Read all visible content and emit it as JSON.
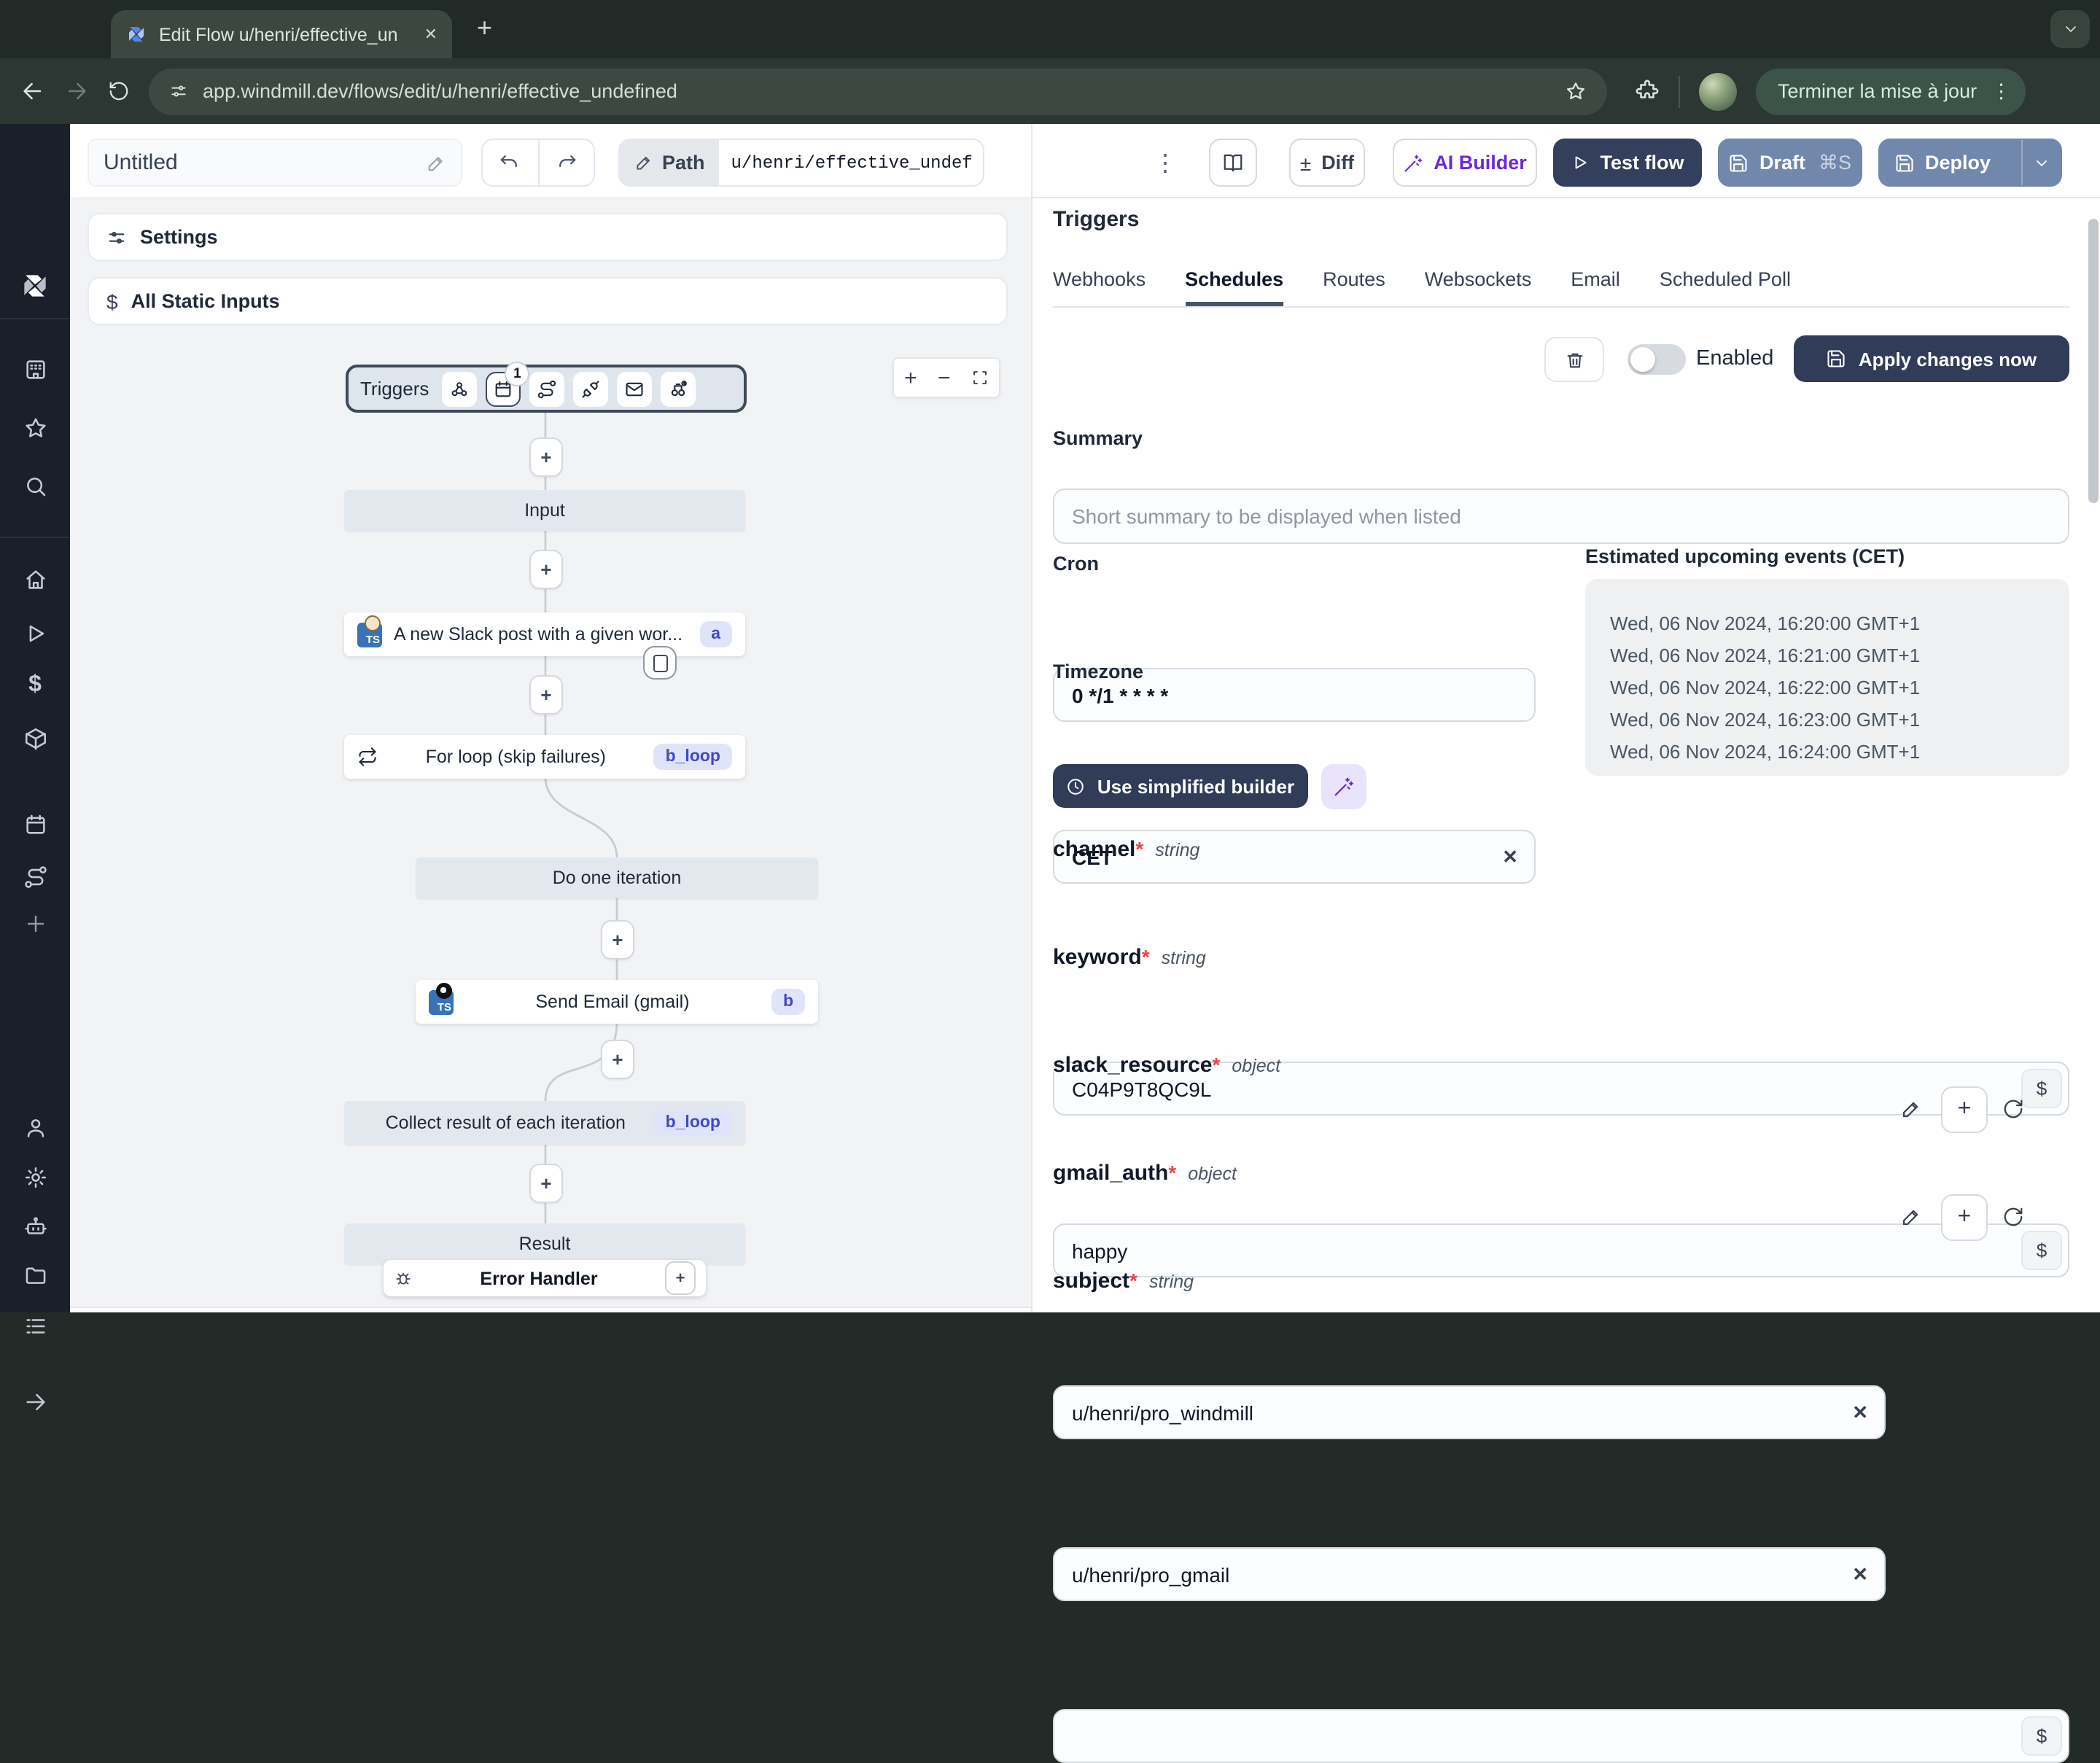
{
  "browser": {
    "tab_title": "Edit Flow u/henri/effective_un",
    "url": "app.windmill.dev/flows/edit/u/henri/effective_undefined",
    "update_button_label": "Terminer la mise à jour"
  },
  "header": {
    "flow_name": "Untitled",
    "path_label": "Path",
    "path_value": "u/henri/effective_undef",
    "diff_label": "Diff",
    "ai_builder_label": "AI Builder",
    "test_flow_label": "Test flow",
    "draft_label": "Draft",
    "draft_shortcut": "⌘S",
    "deploy_label": "Deploy"
  },
  "flow_panel": {
    "settings_label": "Settings",
    "all_static_inputs_label": "All Static Inputs",
    "triggers_node_label": "Triggers",
    "schedule_count_badge": "1",
    "nodes": {
      "input_label": "Input",
      "slack": {
        "label": "A new Slack post with a given wor...",
        "badge": "a"
      },
      "forloop": {
        "label": "For loop (skip failures)",
        "badge": "b_loop"
      },
      "iteration_label": "Do one iteration",
      "email": {
        "label": "Send Email (gmail)",
        "badge": "b"
      },
      "collect": {
        "label": "Collect result of each iteration",
        "badge": "b_loop"
      },
      "result_label": "Result",
      "error_handler_label": "Error Handler"
    }
  },
  "panel": {
    "title": "Triggers",
    "tabs": [
      "Webhooks",
      "Schedules",
      "Routes",
      "Websockets",
      "Email",
      "Scheduled Poll"
    ],
    "active_tab": "Schedules",
    "enabled_label": "Enabled",
    "apply_button_label": "Apply changes now",
    "summary_label": "Summary",
    "summary_placeholder": "Short summary to be displayed when listed",
    "cron_label": "Cron",
    "cron_value": "0 */1 * * * *",
    "timezone_label": "Timezone",
    "timezone_value": "CET",
    "events_title": "Estimated upcoming events (CET)",
    "events": [
      "Wed, 06 Nov 2024, 16:20:00 GMT+1",
      "Wed, 06 Nov 2024, 16:21:00 GMT+1",
      "Wed, 06 Nov 2024, 16:22:00 GMT+1",
      "Wed, 06 Nov 2024, 16:23:00 GMT+1",
      "Wed, 06 Nov 2024, 16:24:00 GMT+1"
    ],
    "simplified_builder_label": "Use simplified builder",
    "required_mark": "*",
    "fields": {
      "channel": {
        "name": "channel",
        "type": "string",
        "value": "C04P9T8QC9L"
      },
      "keyword": {
        "name": "keyword",
        "type": "string",
        "value": "happy"
      },
      "slack_resource": {
        "name": "slack_resource",
        "type": "object",
        "value": "u/henri/pro_windmill"
      },
      "gmail_auth": {
        "name": "gmail_auth",
        "type": "object",
        "value": "u/henri/pro_gmail"
      },
      "subject": {
        "name": "subject",
        "type": "string"
      }
    }
  },
  "glyphs": {
    "plus": "+",
    "minus": "−",
    "close": "✕",
    "kebab": "⋮",
    "plus_minus": "±",
    "dollar": "$"
  },
  "colors": {
    "accent_navy": "#313c59",
    "accent_slate": "#7187ac",
    "accent_purple": "#6d28d9",
    "badge_bg": "#e0e4fb",
    "badge_text": "#4348c9",
    "chrome_bg": "#2c3632"
  }
}
